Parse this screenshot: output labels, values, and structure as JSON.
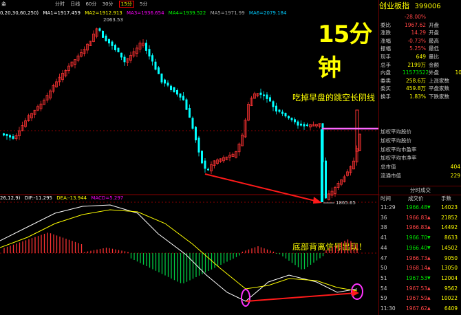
{
  "header": {
    "left_label": "金",
    "period_tabs": [
      "分时",
      "日线",
      "60分",
      "30分",
      "15分",
      "5分"
    ],
    "active_tab": "15分",
    "ma_params": "0,20,30,60,250)",
    "ma": [
      {
        "label": "MA1=1917.459",
        "color": "#ffffff"
      },
      {
        "label": "MA2=1912.913",
        "color": "#ffff00"
      },
      {
        "label": "MA3=1936.654",
        "color": "#ff00ff"
      },
      {
        "label": "MA4=1939.522",
        "color": "#00ff00"
      },
      {
        "label": "MA5=1971.99",
        "color": "#aaaaaa"
      },
      {
        "label": "MA6=2079.184",
        "color": "#00ccff"
      }
    ]
  },
  "chart_annotations": {
    "timeframe_stamp": "15分钟",
    "high_label": "2063.53",
    "low_label": "1865.65",
    "note_gap": "吃掉早盘的跳空长阴线",
    "note_divergence": "底部背离信号出现！"
  },
  "macd": {
    "params": "26,12,9)",
    "dif": "DIF:-11.295",
    "dea": "DEA:-13.944",
    "macd": "MACD=5.297"
  },
  "chart_data": {
    "type": "candlestick",
    "title": "创业板指 15分钟",
    "high": 2063.53,
    "low": 1865.65,
    "ma_values": {
      "MA1": 1917.459,
      "MA2": 1912.913,
      "MA3": 1936.654,
      "MA4": 1939.522,
      "MA5": 1971.99,
      "MA6": 2079.184
    },
    "macd_values": {
      "DIF": -11.295,
      "DEA": -13.944,
      "MACD": 5.297
    }
  },
  "sidebar": {
    "title": "创业板指",
    "code": "399006",
    "quote_rows": [
      {
        "label": "",
        "val": "-28.00%",
        "color": "#ff4444",
        "label2": "",
        "val2": ""
      },
      {
        "label": "委比",
        "val": "1967.62",
        "color": "#ff4444",
        "label2": "开盘",
        "val2": ""
      },
      {
        "label": "涨跌",
        "val": "14.29",
        "color": "#ff4444",
        "label2": "开盘",
        "val2": ""
      },
      {
        "label": "涨幅",
        "val": "-0.73%",
        "color": "#ff4444",
        "label2": "最高",
        "val2": ""
      },
      {
        "label": "振幅",
        "val": "5.25%",
        "color": "#ff4444",
        "label2": "最低",
        "val2": ""
      },
      {
        "label": "现手",
        "val": "649",
        "color": "#ffff00",
        "label2": "量比",
        "val2": ""
      },
      {
        "label": "总手",
        "val": "2199万",
        "color": "#ffff00",
        "label2": "金额",
        "val2": ""
      },
      {
        "label": "内盘",
        "val": "11573522",
        "color": "#00e600",
        "label2": "外盘",
        "val2": "10"
      },
      {
        "label": "委卖",
        "val": "258.6万",
        "color": "#ffff00",
        "label2": "上涨家数",
        "val2": ""
      },
      {
        "label": "委买",
        "val": "459.8万",
        "color": "#ffff00",
        "label2": "平盘家数",
        "val2": ""
      },
      {
        "label": "换手",
        "val": "1.83%",
        "color": "#ffff00",
        "label2": "下跌家数",
        "val2": ""
      }
    ],
    "info_rows": [
      {
        "label": "加权平均股价",
        "val": ""
      },
      {
        "label": "加权平均股价",
        "val": ""
      },
      {
        "label": "加权平均市盈率",
        "val": ""
      },
      {
        "label": "加权平均市净率",
        "val": ""
      },
      {
        "label": "总市值",
        "val": "404"
      },
      {
        "label": "流通市值",
        "val": "229"
      }
    ],
    "ticks_title": "分时成交",
    "ticks_header": [
      "时间",
      "成交价",
      "手数"
    ],
    "ticks": [
      {
        "t": "11:29",
        "p": "1966.48",
        "d": "down",
        "v": "14023"
      },
      {
        "t": "36",
        "p": "1966.83",
        "d": "up",
        "v": "21852"
      },
      {
        "t": "38",
        "p": "1966.83",
        "d": "up",
        "v": "14492"
      },
      {
        "t": "41",
        "p": "1966.70",
        "d": "down",
        "v": "8633"
      },
      {
        "t": "44",
        "p": "1966.40",
        "d": "down",
        "v": "14502"
      },
      {
        "t": "47",
        "p": "1966.73",
        "d": "up",
        "v": "9050"
      },
      {
        "t": "50",
        "p": "1968.14",
        "d": "up",
        "v": "13050"
      },
      {
        "t": "51",
        "p": "1967.53",
        "d": "down",
        "v": "12004"
      },
      {
        "t": "54",
        "p": "1967.53",
        "d": "up",
        "v": "9562"
      },
      {
        "t": "59",
        "p": "1967.59",
        "d": "up",
        "v": "10022"
      },
      {
        "t": "11:30",
        "p": "1967.62",
        "d": "up",
        "v": "6409"
      }
    ]
  }
}
